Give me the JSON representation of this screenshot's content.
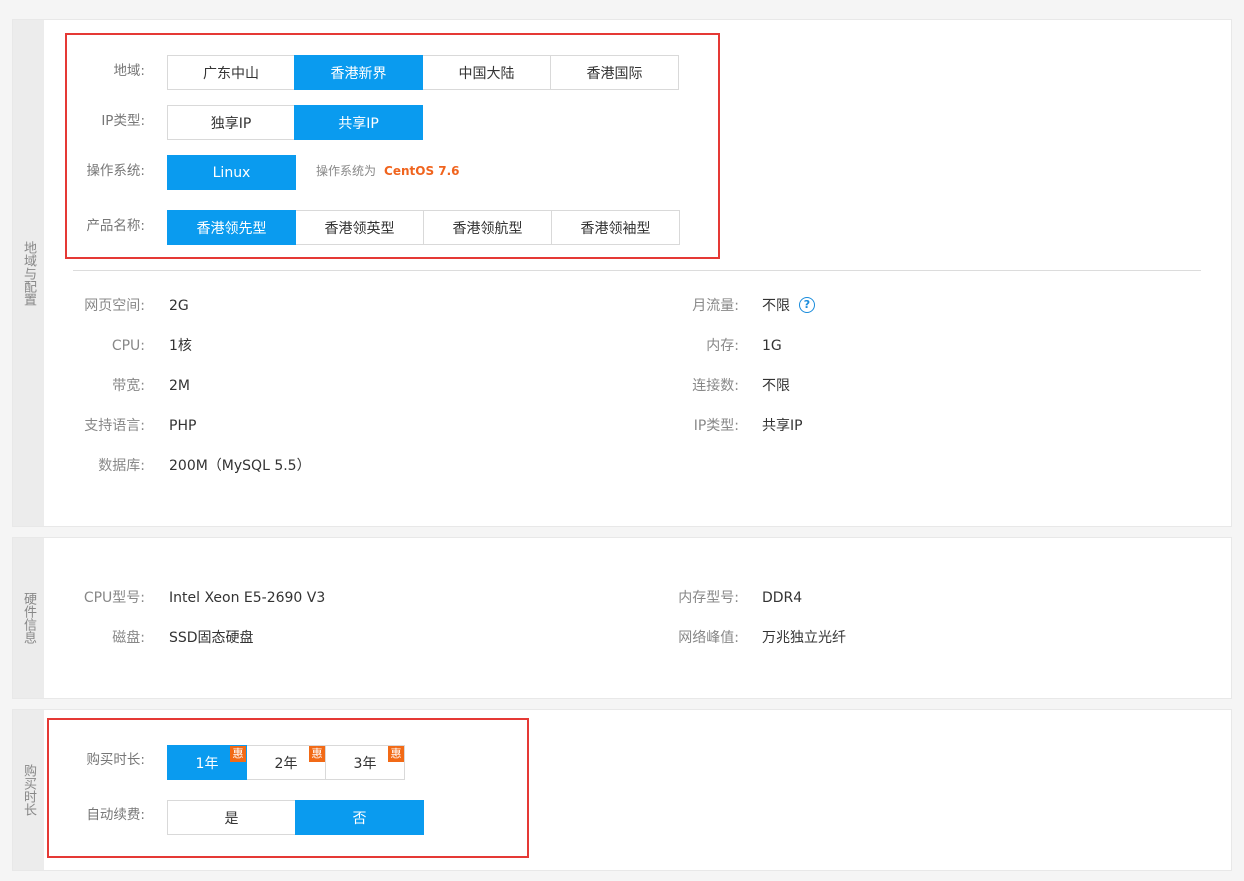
{
  "region_config": {
    "tab_label": "地域与配置",
    "region": {
      "label": "地域:",
      "options": [
        "广东中山",
        "香港新界",
        "中国大陆",
        "香港国际"
      ],
      "selected": 1
    },
    "ip_type": {
      "label": "IP类型:",
      "options": [
        "独享IP",
        "共享IP"
      ],
      "selected": 1
    },
    "os": {
      "label": "操作系统:",
      "options": [
        "Linux"
      ],
      "selected": 0,
      "note_prefix": "操作系统为",
      "note_value": "CentOS 7.6"
    },
    "product": {
      "label": "产品名称:",
      "options": [
        "香港领先型",
        "香港领英型",
        "香港领航型",
        "香港领袖型"
      ],
      "selected": 0
    },
    "specs": {
      "web_space": {
        "label": "网页空间:",
        "value": "2G"
      },
      "cpu": {
        "label": "CPU:",
        "value": "1核"
      },
      "bandwidth": {
        "label": "带宽:",
        "value": "2M"
      },
      "language": {
        "label": "支持语言:",
        "value": "PHP"
      },
      "database": {
        "label": "数据库:",
        "value": "200M（MySQL 5.5）"
      },
      "monthly_traffic": {
        "label": "月流量:",
        "value": "不限",
        "help": "?"
      },
      "memory": {
        "label": "内存:",
        "value": "1G"
      },
      "connections": {
        "label": "连接数:",
        "value": "不限"
      },
      "ip_type": {
        "label": "IP类型:",
        "value": "共享IP"
      }
    }
  },
  "hardware": {
    "tab_label": "硬件信息",
    "cpu_model": {
      "label": "CPU型号:",
      "value": "Intel Xeon E5-2690 V3"
    },
    "disk": {
      "label": "磁盘:",
      "value": "SSD固态硬盘"
    },
    "memory_model": {
      "label": "内存型号:",
      "value": "DDR4"
    },
    "network_peak": {
      "label": "网络峰值:",
      "value": "万兆独立光纤"
    }
  },
  "purchase": {
    "tab_label": "购买时长",
    "duration": {
      "label": "购买时长:",
      "options": [
        "1年",
        "2年",
        "3年"
      ],
      "badge": "惠",
      "selected": 0
    },
    "auto_renew": {
      "label": "自动续费:",
      "options": [
        "是",
        "否"
      ],
      "selected": 1
    }
  },
  "colors": {
    "accent": "#0a9bef",
    "highlight_box": "#e53935",
    "badge": "#f26a16",
    "os_version": "#f0641e"
  }
}
